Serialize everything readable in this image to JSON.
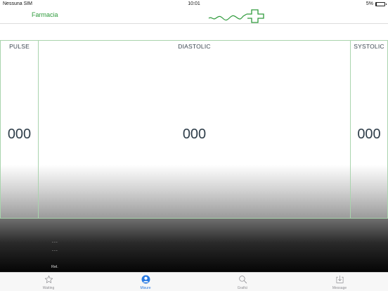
{
  "status_bar": {
    "carrier": "Nessuna SIM",
    "time": "10:01",
    "battery_percent": "5%",
    "battery_level": 0.05
  },
  "nav": {
    "title": "Farmacia",
    "logo_icon": "pharmacy-cross-pulse-icon",
    "accent_color": "#2e9a3b"
  },
  "readings": {
    "pulse": {
      "label": "PULSE",
      "value": "000"
    },
    "diastolic": {
      "label": "DIASTOLIC",
      "value": "000"
    },
    "systolic": {
      "label": "SYSTOLIC",
      "value": "000"
    }
  },
  "lower": {
    "line1": "...",
    "line2": "...",
    "rel_label": "Rel."
  },
  "tabs": [
    {
      "label": "Waiting",
      "icon": "star-icon",
      "active": false
    },
    {
      "label": "Misure",
      "icon": "person-icon",
      "active": true
    },
    {
      "label": "Grafici",
      "icon": "search-icon",
      "active": false
    },
    {
      "label": "Message",
      "icon": "download-tray-icon",
      "active": false
    }
  ],
  "colors": {
    "panel_border": "#a9d4ad",
    "tab_active": "#2a7ae2",
    "tab_inactive": "#8e8e93"
  }
}
